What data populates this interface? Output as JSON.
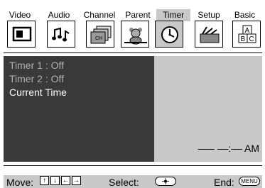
{
  "tabs": [
    {
      "label": "Video"
    },
    {
      "label": "Audio"
    },
    {
      "label": "Channel"
    },
    {
      "label": "Parent"
    },
    {
      "label": "Timer",
      "active": true
    },
    {
      "label": "Setup"
    },
    {
      "label": "Basic"
    }
  ],
  "icons": [
    "display-icon",
    "music-notes-icon",
    "channel-stack-icon",
    "parent-teddy-icon",
    "clock-icon",
    "setup-toolbox-icon",
    "abc-blocks-icon"
  ],
  "menu": {
    "items": [
      {
        "label": "Timer 1 : Off",
        "state": "dim"
      },
      {
        "label": "Timer 2 : Off",
        "state": "dim"
      },
      {
        "label": "Current Time",
        "state": "selected"
      }
    ]
  },
  "panel": {
    "time_display": "––– ––:–– AM"
  },
  "footer": {
    "move_label": "Move:",
    "select_label": "Select:",
    "end_label": "End:",
    "arrow_up": "↑",
    "arrow_down": "↓",
    "arrow_left": "←",
    "arrow_right": "→",
    "menu_key": "MENU"
  },
  "colors": {
    "menu_bg": "#3a3a3a",
    "panel_bg": "#c8c8c8",
    "active_tab": "#c8c8c8"
  }
}
